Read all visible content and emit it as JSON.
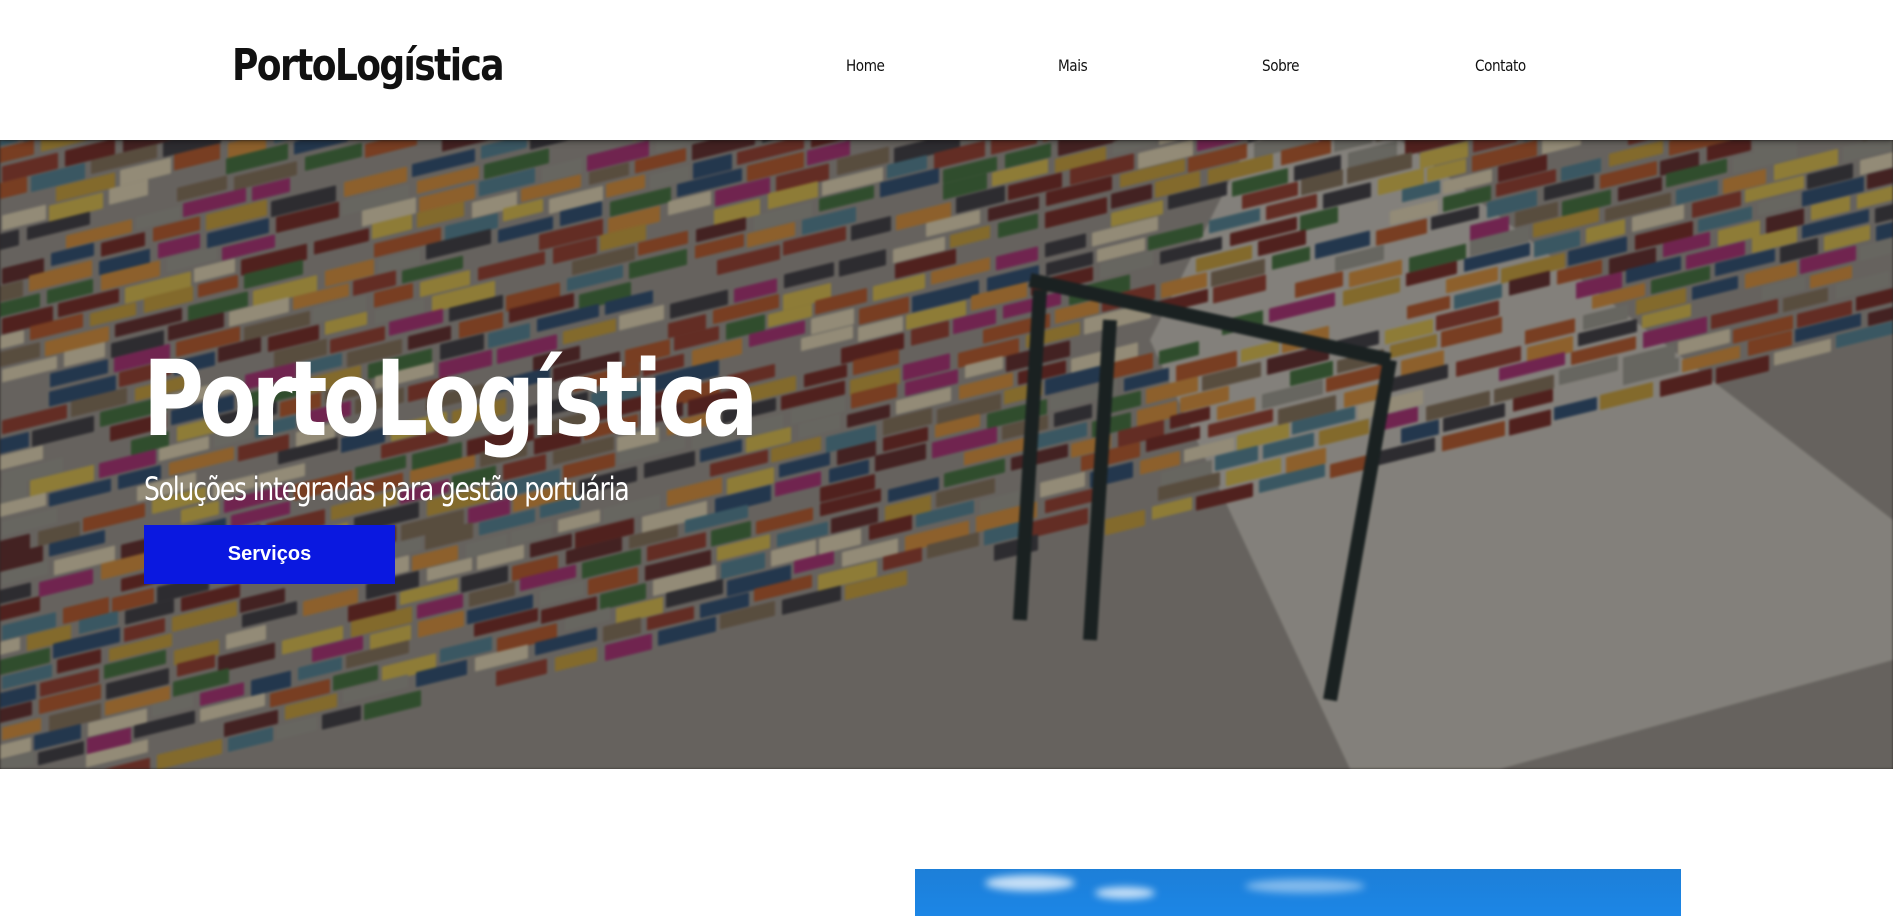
{
  "header": {
    "logo": "PortoLogística",
    "nav": [
      {
        "label": "Home"
      },
      {
        "label": "Mais"
      },
      {
        "label": "Sobre"
      },
      {
        "label": "Contato"
      }
    ]
  },
  "hero": {
    "title": "PortoLogística",
    "subtitle": "Soluções integradas para gestão portuária",
    "button_label": "Serviços",
    "colors": {
      "button": "#0a18e0",
      "text": "#ffffff"
    }
  },
  "section": {
    "image": "harbor-sky-photo"
  }
}
